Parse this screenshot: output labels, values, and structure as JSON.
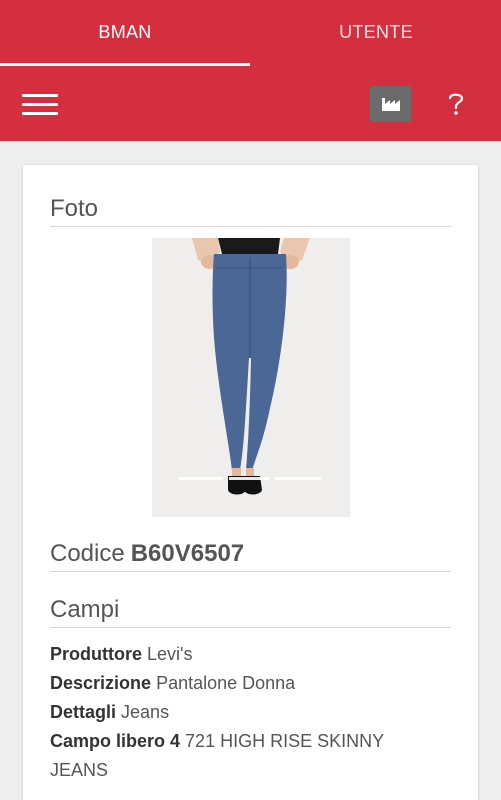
{
  "tabs": [
    {
      "label": "BMAN",
      "active": true
    },
    {
      "label": "UTENTE",
      "active": false
    }
  ],
  "toolbar": {
    "menu_icon": "hamburger-menu-icon",
    "factory_icon": "factory-icon",
    "help_icon": "help-question-icon"
  },
  "colors": {
    "primary": "#d32f3f",
    "toolbar_button": "#6b6b6b"
  },
  "card": {
    "photo_title": "Foto",
    "code_label": "Codice",
    "code_value": "B60V6507",
    "fields_title": "Campi",
    "fields": [
      {
        "label": "Produttore",
        "value": "Levi's"
      },
      {
        "label": "Descrizione",
        "value": "Pantalone Donna"
      },
      {
        "label": "Dettagli",
        "value": "Jeans"
      },
      {
        "label": "Campo libero 4",
        "value": "721 HIGH RISE SKINNY JEANS"
      }
    ]
  }
}
